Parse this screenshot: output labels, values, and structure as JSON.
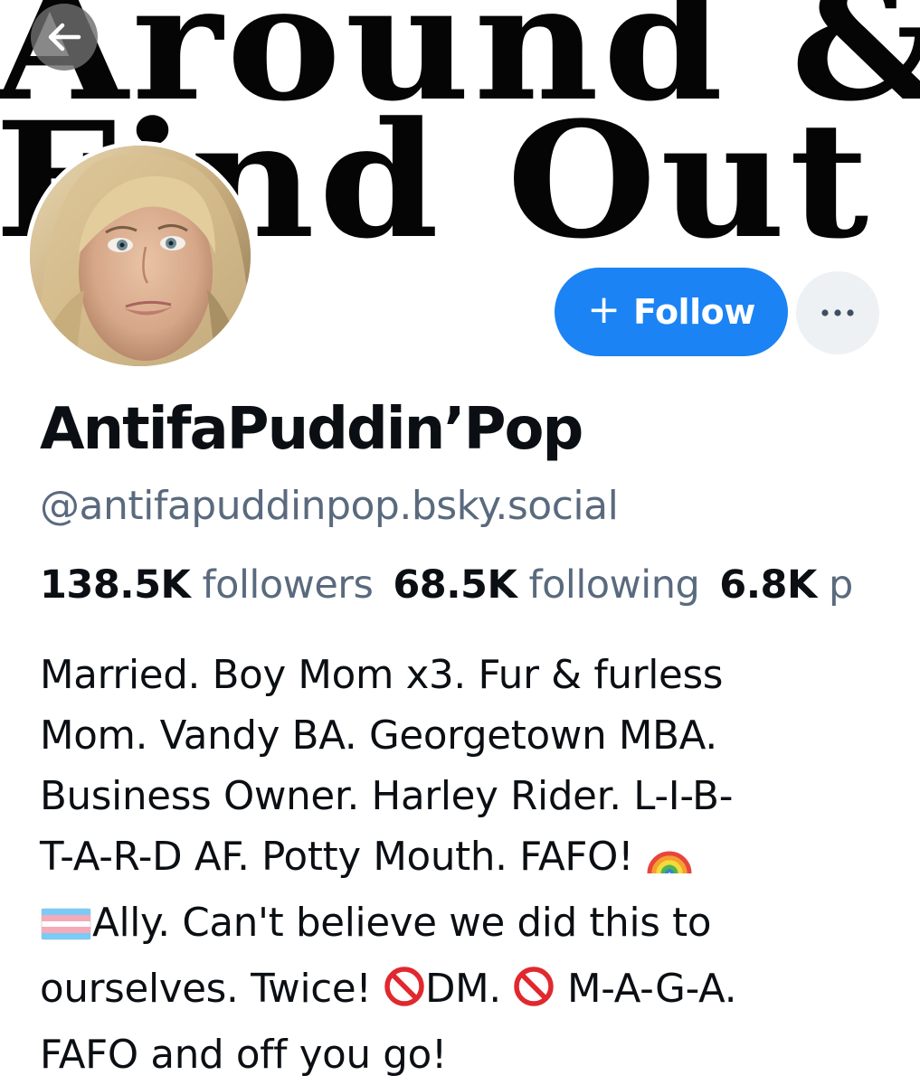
{
  "banner": {
    "line1": "Around &",
    "line2": "Find Out"
  },
  "actions": {
    "follow_plus": "+",
    "follow_label": "Follow",
    "more_label": "···"
  },
  "profile": {
    "display_name": "AntifaPuddin’Pop",
    "handle": "@antifapuddinpop.bsky.social"
  },
  "stats": {
    "followers_count": "138.5K",
    "followers_label": "followers",
    "following_count": "68.5K",
    "following_label": "following",
    "posts_count": "6.8K",
    "posts_label": "p"
  },
  "bio": {
    "line1": "Married. Boy Mom x3. Fur & furless",
    "line2": "Mom. Vandy BA. Georgetown MBA.",
    "line3": "Business Owner. Harley Rider. L-I-B-",
    "line4": "T-A-R-D AF. Potty Mouth. FAFO! ",
    "line5_text": "Ally. Can't believe we did this to",
    "line6_a": "ourselves. Twice! ",
    "line6_b": "DM. ",
    "line6_c": " M-A-G-A.",
    "line7": "FAFO and off you go!"
  },
  "icons": {
    "back": "arrow-left-icon",
    "more": "ellipsis-icon",
    "rainbow": "rainbow-emoji-icon",
    "trans_flag": "transgender-flag-emoji-icon",
    "prohibited": "prohibited-emoji-icon"
  },
  "colors": {
    "follow_button": "#1b83f4",
    "more_button": "#eef1f4",
    "secondary_text": "#5a6a7e",
    "primary_text": "#0b0f14"
  }
}
